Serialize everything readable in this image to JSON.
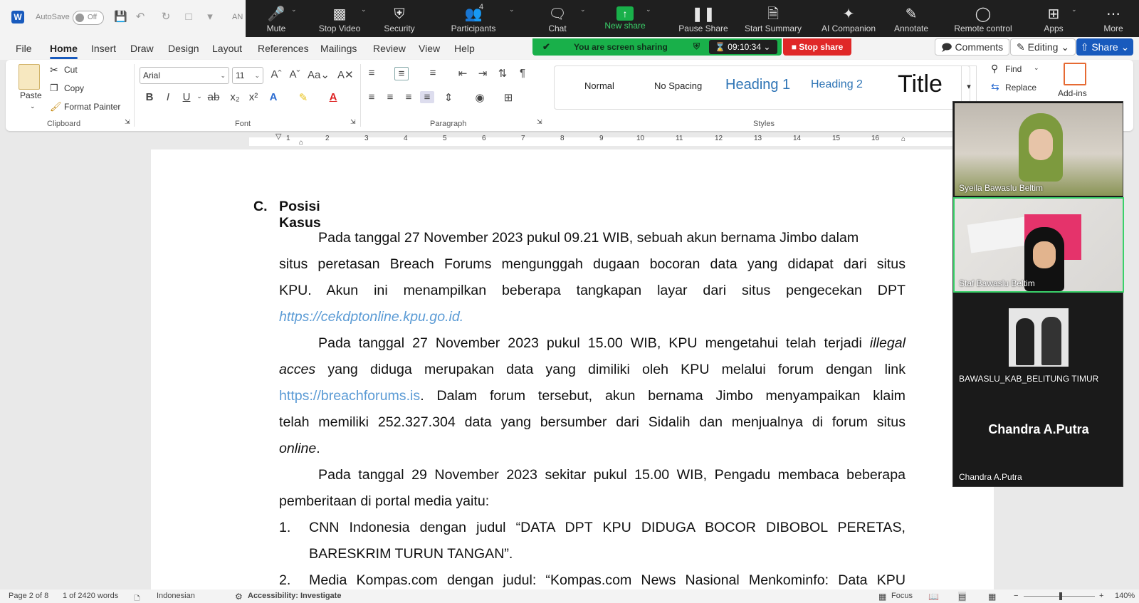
{
  "titlebar": {
    "autosave_label": "AutoSave",
    "autosave_state": "Off",
    "doc_name_fragment": "AN"
  },
  "zoom_toolbar": {
    "items": [
      {
        "label": "Mute",
        "icon": "microphone-icon"
      },
      {
        "label": "Stop Video",
        "icon": "video-camera-icon"
      },
      {
        "label": "Security",
        "icon": "shield-icon"
      },
      {
        "label": "Participants",
        "icon": "people-icon"
      },
      {
        "label": "Chat",
        "icon": "chat-bubble-icon"
      },
      {
        "label": "New share",
        "icon": "share-arrow-icon"
      },
      {
        "label": "Pause Share",
        "icon": "pause-icon"
      },
      {
        "label": "Start Summary",
        "icon": "document-icon"
      },
      {
        "label": "AI Companion",
        "icon": "sparkle-icon"
      },
      {
        "label": "Annotate",
        "icon": "pen-icon"
      },
      {
        "label": "Remote control",
        "icon": "mouse-icon"
      },
      {
        "label": "Apps",
        "icon": "apps-grid-icon"
      },
      {
        "label": "More",
        "icon": "more-dots-icon"
      }
    ],
    "participant_count": "4",
    "sharing_banner": "You are screen sharing",
    "timer": "09:10:34",
    "stop_share": "Stop share",
    "accent_green": "#19b04a",
    "stop_red": "#e02828"
  },
  "menubar": {
    "tabs": [
      "File",
      "Home",
      "Insert",
      "Draw",
      "Design",
      "Layout",
      "References",
      "Mailings",
      "Review",
      "View",
      "Help"
    ],
    "active_tab": "Home",
    "comments": "Comments",
    "editing": "Editing",
    "share": "Share"
  },
  "ribbon": {
    "clipboard": {
      "paste": "Paste",
      "cut": "Cut",
      "copy": "Copy",
      "format_painter": "Format Painter",
      "label": "Clipboard"
    },
    "font": {
      "family": "Arial",
      "size": "11",
      "label": "Font"
    },
    "paragraph": {
      "label": "Paragraph"
    },
    "styles": {
      "items": [
        "Normal",
        "No Spacing",
        "Heading 1",
        "Heading 2",
        "Title"
      ],
      "label": "Styles"
    },
    "editing": {
      "find": "Find",
      "replace": "Replace"
    },
    "addins": {
      "label": "Add-ins"
    }
  },
  "ruler": {
    "numbers": [
      "1",
      "2",
      "3",
      "4",
      "5",
      "6",
      "7",
      "8",
      "9",
      "10",
      "11",
      "12",
      "13",
      "14",
      "15",
      "16"
    ]
  },
  "document": {
    "heading_letter": "C.",
    "heading_text": "Posisi Kasus",
    "p1_lines": [
      "Pada tanggal 27 November 2023 pukul 09.21 WIB, sebuah akun bernama Jimbo dalam",
      "situs peretasan Breach Forums mengunggah dugaan bocoran data yang didapat dari situs",
      "KPU. Akun ini menampilkan beberapa tangkapan layar dari situs pengecekan DPT"
    ],
    "p1_link": "https://cekdptonline.kpu.go.id.",
    "p2_line1_pre": "Pada tanggal 27 November 2023 pukul 15.00 WIB, KPU mengetahui telah terjadi ",
    "p2_line1_ital": "illegal",
    "p2_line2_ital": "acces",
    "p2_line2_rest": " yang diduga merupakan data yang dimiliki oleh KPU melalui forum dengan link",
    "p2_link": "https://breachforums.is",
    "p2_line3_rest": ". Dalam forum tersebut, akun bernama Jimbo menyampaikan klaim",
    "p2_line4": "telah memiliki 252.327.304 data yang bersumber dari Sidalih dan menjualnya di forum situs",
    "p2_line5_ital": "online",
    "p2_line5_rest": ".",
    "p3_line1": "Pada tanggal 29 November 2023 sekitar pukul 15.00 WIB, Pengadu membaca beberapa",
    "p3_line2": "pemberitaan di portal media yaitu:",
    "list": [
      {
        "num": "1.",
        "line1": "CNN Indonesia dengan judul “DATA DPT KPU DIDUGA BOCOR DIBOBOL PERETAS,",
        "line2": "BARESKRIM TURUN TANGAN”."
      },
      {
        "num": "2.",
        "line1": "Media Kompas.com dengan judul: “Kompas.com News Nasional Menkominfo: Data KPU"
      }
    ]
  },
  "gallery": {
    "tiles": [
      {
        "name": "Syeila Bawaslu Beltim"
      },
      {
        "name": "Staf Bawaslu Beltim",
        "active": true
      },
      {
        "name": "BAWASLU_KAB_BELITUNG TIMUR"
      },
      {
        "name": "Chandra A.Putra",
        "center_text": "Chandra A.Putra"
      }
    ]
  },
  "statusbar": {
    "page": "Page 2 of 8",
    "words": "1 of 2420 words",
    "language": "Indonesian",
    "accessibility": "Accessibility: Investigate",
    "focus": "Focus",
    "zoom": "140%"
  }
}
